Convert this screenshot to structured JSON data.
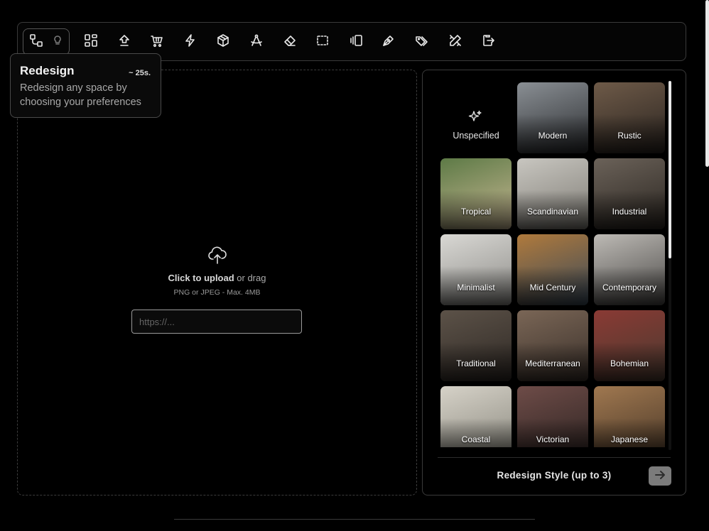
{
  "toolbar": {
    "tools": [
      {
        "name": "layout-grid-icon"
      },
      {
        "name": "upscale-icon"
      },
      {
        "name": "furnish-cart-icon"
      },
      {
        "name": "lightning-icon"
      },
      {
        "name": "cube-icon"
      },
      {
        "name": "compass-icon"
      },
      {
        "name": "eraser-icon"
      },
      {
        "name": "select-area-icon"
      },
      {
        "name": "panels-icon"
      },
      {
        "name": "pen-icon"
      },
      {
        "name": "tags-icon"
      },
      {
        "name": "design-tools-icon"
      },
      {
        "name": "export-icon"
      }
    ]
  },
  "tooltip": {
    "title": "Redesign",
    "time": "~ 25s.",
    "description": "Redesign any space by choosing your preferences"
  },
  "upload": {
    "action": "Click to upload",
    "or_drag": " or drag",
    "hint": "PNG or JPEG - Max. 4MB",
    "url_placeholder": "https://..."
  },
  "styles": {
    "items": [
      {
        "label": "Unspecified",
        "colors": [
          "#000000",
          "#000000"
        ]
      },
      {
        "label": "Modern",
        "colors": [
          "#8a8f94",
          "#2b2d30"
        ]
      },
      {
        "label": "Rustic",
        "colors": [
          "#6e5a48",
          "#2a2420"
        ]
      },
      {
        "label": "Tropical",
        "colors": [
          "#5d7a46",
          "#c9b894"
        ]
      },
      {
        "label": "Scandinavian",
        "colors": [
          "#c8c6c0",
          "#7e7b74"
        ]
      },
      {
        "label": "Industrial",
        "colors": [
          "#6b6259",
          "#2a2520"
        ]
      },
      {
        "label": "Minimalist",
        "colors": [
          "#d9d8d4",
          "#8d8c88"
        ]
      },
      {
        "label": "Mid Century",
        "colors": [
          "#b07a3c",
          "#3a4a5a"
        ]
      },
      {
        "label": "Contemporary",
        "colors": [
          "#bdbab5",
          "#4a4846"
        ]
      },
      {
        "label": "Traditional",
        "colors": [
          "#5c5248",
          "#2e2824"
        ]
      },
      {
        "label": "Mediterranean",
        "colors": [
          "#7a6656",
          "#3a302a"
        ]
      },
      {
        "label": "Bohemian",
        "colors": [
          "#8a3a34",
          "#4a3a30"
        ]
      },
      {
        "label": "Coastal",
        "colors": [
          "#d6d2c8",
          "#8c8a80"
        ]
      },
      {
        "label": "Victorian",
        "colors": [
          "#6e4c48",
          "#2e2422"
        ]
      },
      {
        "label": "Japanese",
        "colors": [
          "#a07850",
          "#4a3828"
        ]
      }
    ],
    "footer_label": "Redesign Style (up to 3)"
  }
}
